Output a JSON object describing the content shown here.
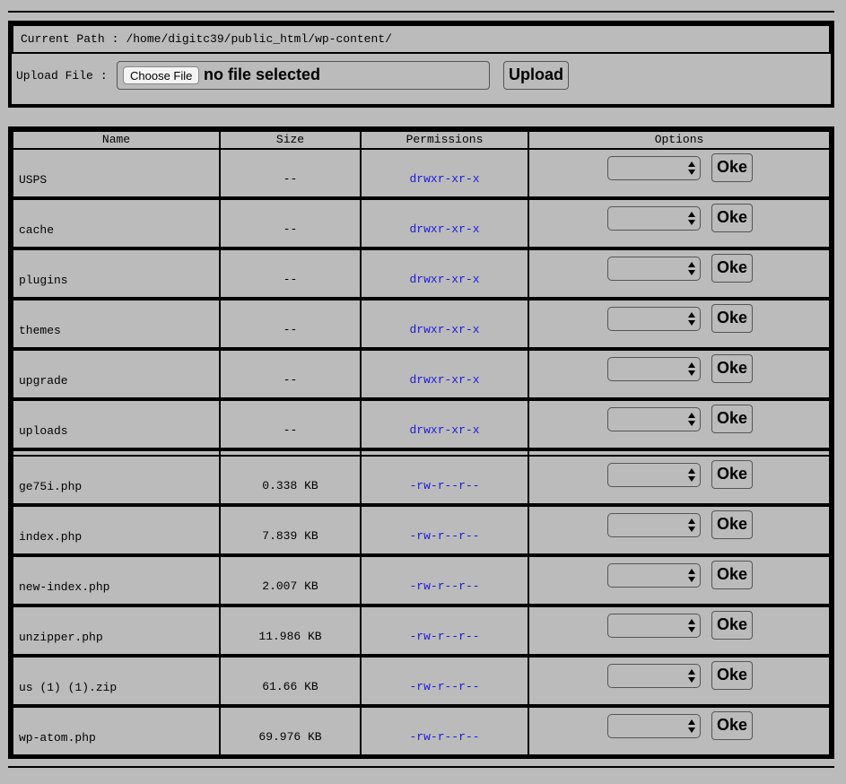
{
  "upload": {
    "path_label": "Current Path",
    "path_sep": ":",
    "path_value": "/home/digitc39/public_html/wp-content/",
    "upload_label": "Upload File",
    "upload_sep": ":",
    "choose_label": "Choose File",
    "no_file_text": "no file selected",
    "upload_button": "Upload"
  },
  "table": {
    "headers": {
      "name": "Name",
      "size": "Size",
      "permissions": "Permissions",
      "options": "Options"
    },
    "oke_label": "Oke",
    "permission_color": "#1a1ad9",
    "select_icon": "select-arrows-icon",
    "rows": [
      {
        "name": "USPS",
        "size": "--",
        "permissions": "drwxr-xr-x",
        "option": ""
      },
      {
        "name": "cache",
        "size": "--",
        "permissions": "drwxr-xr-x",
        "option": ""
      },
      {
        "name": "plugins",
        "size": "--",
        "permissions": "drwxr-xr-x",
        "option": ""
      },
      {
        "name": "themes",
        "size": "--",
        "permissions": "drwxr-xr-x",
        "option": ""
      },
      {
        "name": "upgrade",
        "size": "--",
        "permissions": "drwxr-xr-x",
        "option": ""
      },
      {
        "name": "uploads",
        "size": "--",
        "permissions": "drwxr-xr-x",
        "option": ""
      },
      {
        "name": "ge75i.php",
        "size": "0.338 KB",
        "permissions": "-rw-r--r--",
        "option": ""
      },
      {
        "name": "index.php",
        "size": "7.839 KB",
        "permissions": "-rw-r--r--",
        "option": ""
      },
      {
        "name": "new-index.php",
        "size": "2.007 KB",
        "permissions": "-rw-r--r--",
        "option": ""
      },
      {
        "name": "unzipper.php",
        "size": "11.986 KB",
        "permissions": "-rw-r--r--",
        "option": ""
      },
      {
        "name": "us (1) (1).zip",
        "size": "61.66 KB",
        "permissions": "-rw-r--r--",
        "option": ""
      },
      {
        "name": "wp-atom.php",
        "size": "69.976 KB",
        "permissions": "-rw-r--r--",
        "option": ""
      }
    ]
  }
}
